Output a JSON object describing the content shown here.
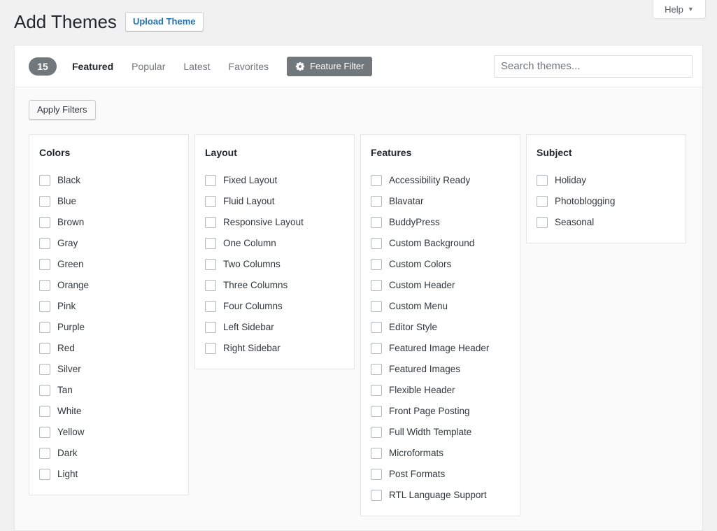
{
  "header": {
    "title": "Add Themes",
    "upload_button": "Upload Theme",
    "help_label": "Help",
    "help_caret": "▼"
  },
  "navbar": {
    "count": "15",
    "tabs": [
      {
        "label": "Featured",
        "active": true
      },
      {
        "label": "Popular",
        "active": false
      },
      {
        "label": "Latest",
        "active": false
      },
      {
        "label": "Favorites",
        "active": false
      }
    ],
    "feature_filter_label": "Feature Filter",
    "feature_filter_icon": "gear-icon",
    "search_placeholder": "Search themes...",
    "search_value": ""
  },
  "filter_drawer": {
    "apply_filters_label": "Apply Filters",
    "groups": [
      {
        "title": "Colors",
        "items": [
          {
            "label": "Black",
            "checked": false
          },
          {
            "label": "Blue",
            "checked": false
          },
          {
            "label": "Brown",
            "checked": false
          },
          {
            "label": "Gray",
            "checked": false
          },
          {
            "label": "Green",
            "checked": false
          },
          {
            "label": "Orange",
            "checked": false
          },
          {
            "label": "Pink",
            "checked": false
          },
          {
            "label": "Purple",
            "checked": false
          },
          {
            "label": "Red",
            "checked": false
          },
          {
            "label": "Silver",
            "checked": false
          },
          {
            "label": "Tan",
            "checked": false
          },
          {
            "label": "White",
            "checked": false
          },
          {
            "label": "Yellow",
            "checked": false
          },
          {
            "label": "Dark",
            "checked": false
          },
          {
            "label": "Light",
            "checked": false
          }
        ]
      },
      {
        "title": "Layout",
        "items": [
          {
            "label": "Fixed Layout",
            "checked": false
          },
          {
            "label": "Fluid Layout",
            "checked": false
          },
          {
            "label": "Responsive Layout",
            "checked": false
          },
          {
            "label": "One Column",
            "checked": false
          },
          {
            "label": "Two Columns",
            "checked": false
          },
          {
            "label": "Three Columns",
            "checked": false
          },
          {
            "label": "Four Columns",
            "checked": false
          },
          {
            "label": "Left Sidebar",
            "checked": false
          },
          {
            "label": "Right Sidebar",
            "checked": false
          }
        ]
      },
      {
        "title": "Features",
        "items": [
          {
            "label": "Accessibility Ready",
            "checked": false
          },
          {
            "label": "Blavatar",
            "checked": false
          },
          {
            "label": "BuddyPress",
            "checked": false
          },
          {
            "label": "Custom Background",
            "checked": false
          },
          {
            "label": "Custom Colors",
            "checked": false
          },
          {
            "label": "Custom Header",
            "checked": false
          },
          {
            "label": "Custom Menu",
            "checked": false
          },
          {
            "label": "Editor Style",
            "checked": false
          },
          {
            "label": "Featured Image Header",
            "checked": false
          },
          {
            "label": "Featured Images",
            "checked": false
          },
          {
            "label": "Flexible Header",
            "checked": false
          },
          {
            "label": "Front Page Posting",
            "checked": false
          },
          {
            "label": "Full Width Template",
            "checked": false
          },
          {
            "label": "Microformats",
            "checked": false
          },
          {
            "label": "Post Formats",
            "checked": false
          },
          {
            "label": "RTL Language Support",
            "checked": false
          }
        ]
      },
      {
        "title": "Subject",
        "items": [
          {
            "label": "Holiday",
            "checked": false
          },
          {
            "label": "Photoblogging",
            "checked": false
          },
          {
            "label": "Seasonal",
            "checked": false
          }
        ]
      }
    ]
  },
  "colors": {
    "page_background": "#f1f1f1",
    "panel_background": "#ffffff",
    "drawer_background": "#fafafa",
    "accent_link": "#2271b1",
    "badge_background": "#72777c",
    "feature_filter_background": "#72777c",
    "border": "#e5e5e5",
    "text_primary": "#23282d",
    "text_muted": "#72777c"
  }
}
